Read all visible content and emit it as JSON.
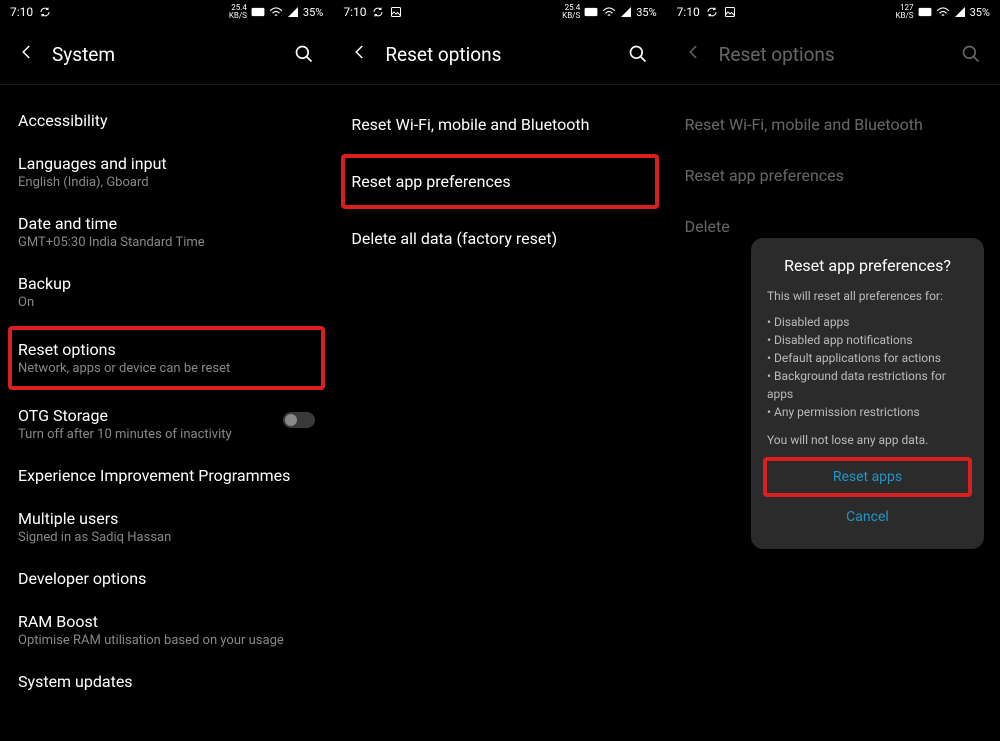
{
  "status": {
    "time": "7:10",
    "net": "25.4",
    "net_unit": "KB/S",
    "net3": "127",
    "net3_unit": "KB/S",
    "battery": "35%"
  },
  "panel1": {
    "title": "System",
    "items": [
      {
        "title": "Accessibility",
        "sub": ""
      },
      {
        "title": "Languages and input",
        "sub": "English (India), Gboard"
      },
      {
        "title": "Date and time",
        "sub": "GMT+05:30 India Standard Time"
      },
      {
        "title": "Backup",
        "sub": "On"
      },
      {
        "title": "Reset options",
        "sub": "Network, apps or device can be reset"
      },
      {
        "title": "OTG Storage",
        "sub": "Turn off after 10 minutes of inactivity"
      },
      {
        "title": "Experience Improvement Programmes",
        "sub": ""
      },
      {
        "title": "Multiple users",
        "sub": "Signed in as Sadiq Hassan"
      },
      {
        "title": "Developer options",
        "sub": ""
      },
      {
        "title": "RAM Boost",
        "sub": "Optimise RAM utilisation based on your usage"
      },
      {
        "title": "System updates",
        "sub": ""
      }
    ]
  },
  "panel2": {
    "title": "Reset options",
    "items": [
      "Reset Wi-Fi, mobile and Bluetooth",
      "Reset app preferences",
      "Delete all data (factory reset)"
    ]
  },
  "panel3": {
    "title": "Reset options",
    "items": [
      "Reset Wi-Fi, mobile and Bluetooth",
      "Reset app preferences",
      "Delete"
    ],
    "dialog": {
      "title": "Reset app preferences?",
      "intro": "This will reset all preferences for:",
      "bullets": [
        "Disabled apps",
        "Disabled app notifications",
        "Default applications for actions",
        "Background data restrictions for apps",
        "Any permission restrictions"
      ],
      "note": "You will not lose any app data.",
      "primary": "Reset apps",
      "cancel": "Cancel"
    }
  }
}
